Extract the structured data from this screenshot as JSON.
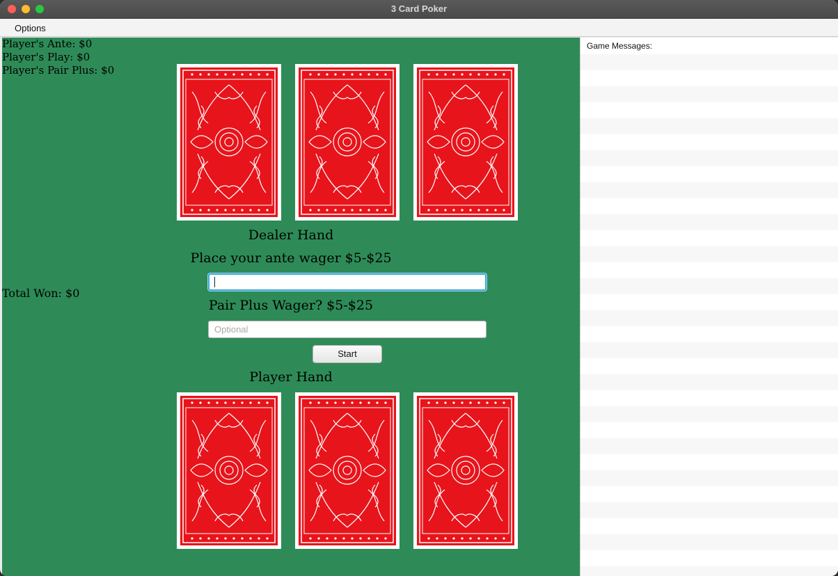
{
  "window": {
    "title": "3 Card Poker"
  },
  "menu": {
    "options_label": "Options"
  },
  "stats": {
    "ante": "Player's Ante: $0",
    "play": "Player's Play: $0",
    "pair_plus": "Player's Pair Plus: $0",
    "total_won": "Total Won: $0"
  },
  "dealer": {
    "label": "Dealer Hand",
    "cards": [
      "card-back",
      "card-back",
      "card-back"
    ]
  },
  "player": {
    "label": "Player Hand",
    "cards": [
      "card-back",
      "card-back",
      "card-back"
    ]
  },
  "wager": {
    "ante_prompt": "Place your ante wager $5-$25",
    "ante_value": "",
    "pair_plus_prompt": "Pair Plus Wager? $5-$25",
    "pair_plus_placeholder": "Optional",
    "start_label": "Start"
  },
  "messages": {
    "header": "Game Messages:",
    "items": []
  },
  "colors": {
    "felt": "#2e8b57",
    "card_back": "#e8141b"
  }
}
